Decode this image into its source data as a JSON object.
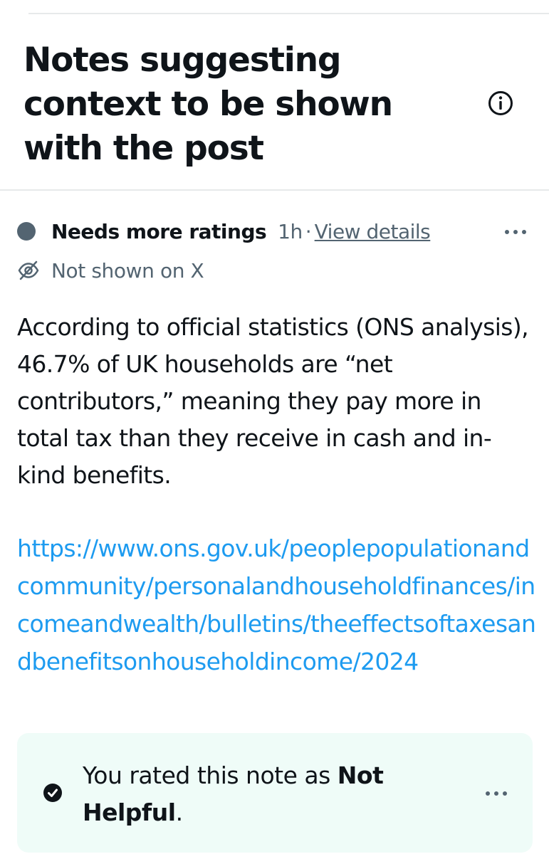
{
  "header": {
    "title": "Notes suggesting context to be shown with the post",
    "info_icon": "info-circle-icon"
  },
  "note": {
    "status_label": "Needs more ratings",
    "age": "1h",
    "separator": "·",
    "view_details_label": "View details",
    "more_icon": "more-horizontal-icon",
    "visibility_icon": "eye-off-icon",
    "visibility_text": "Not shown on X",
    "body": "According to official statistics (ONS analysis), 46.7% of UK households are “net contributors,” meaning they pay more in total tax than they receive in cash and in-kind benefits.",
    "link": "https://www.ons.gov.uk/peoplepopulationandcommunity/personalandhouseholdfinances/incomeandwealth/bulletins/theeffectsoftaxesandbenefitsonhouseholdincome/2024"
  },
  "rating": {
    "prefix": "You rated this note as ",
    "value": "Not Helpful",
    "suffix": ".",
    "check_icon": "check-circle-icon",
    "more_icon": "more-horizontal-icon"
  },
  "colors": {
    "text": "#0f1419",
    "secondary": "#536471",
    "link": "#1d9bf0",
    "rating_bg": "#effcf8",
    "divider": "#e7e9ea"
  }
}
